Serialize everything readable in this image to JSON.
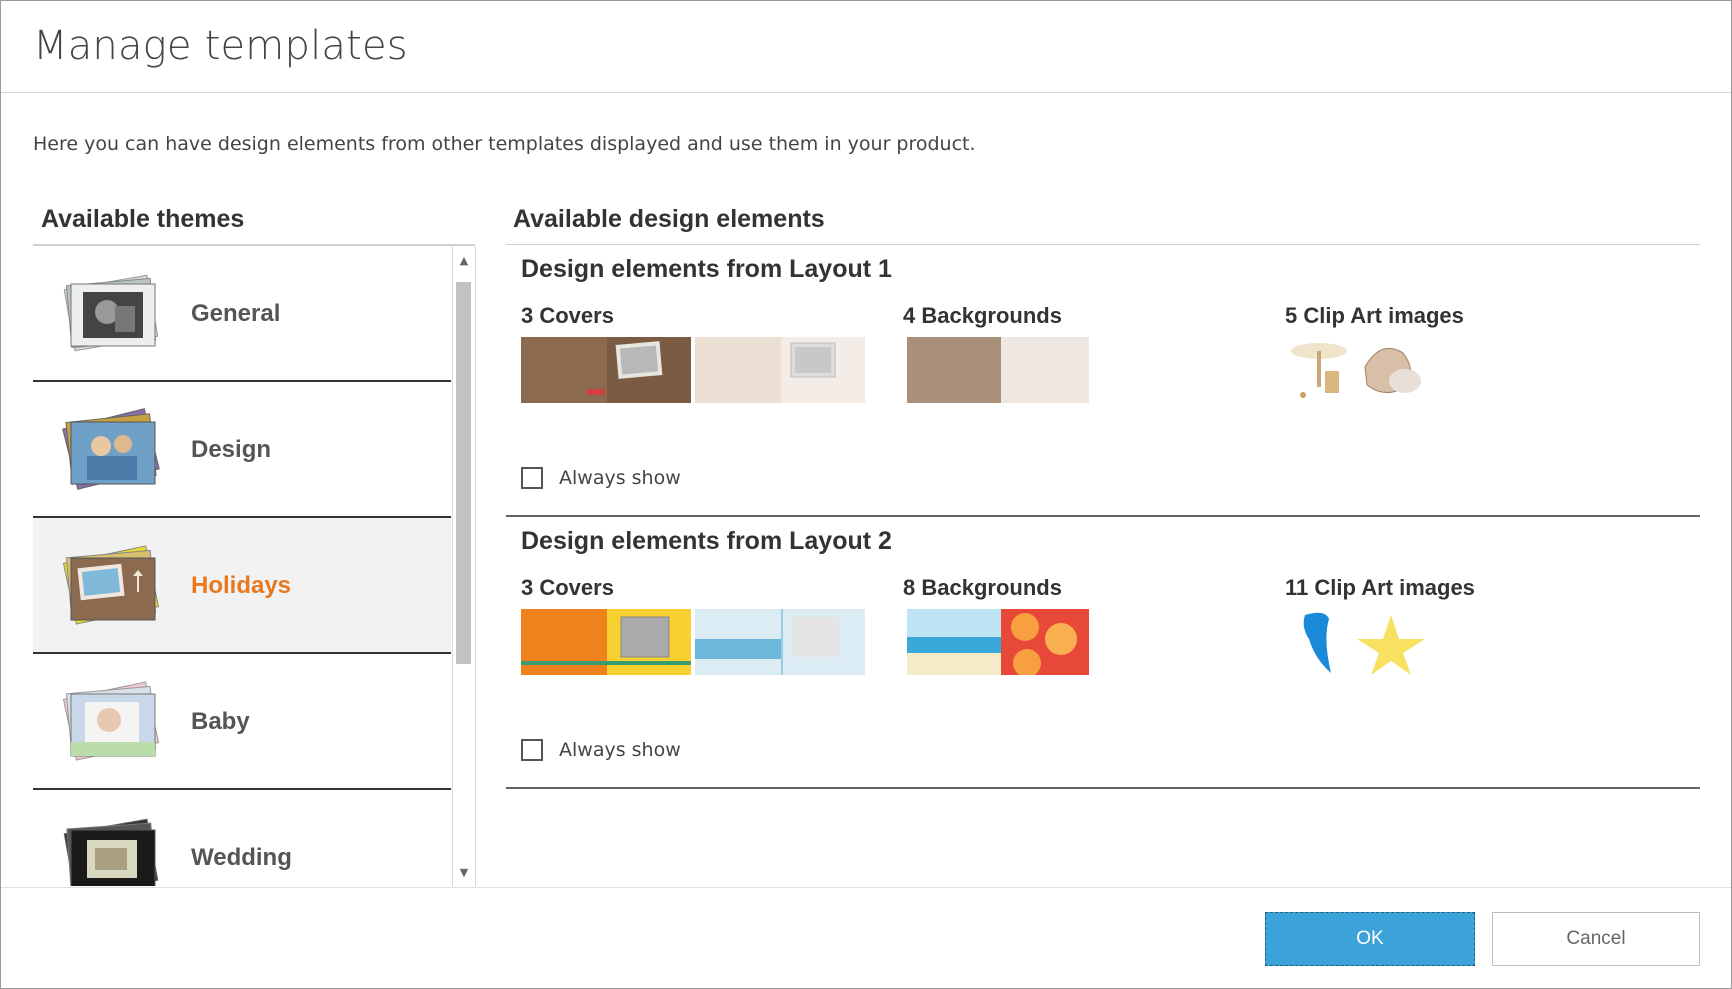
{
  "dialog": {
    "title": "Manage templates",
    "description": "Here you can have design elements from other templates displayed and use them in your product."
  },
  "themes": {
    "heading": "Available themes",
    "items": [
      {
        "label": "General"
      },
      {
        "label": "Design"
      },
      {
        "label": "Holidays",
        "selected": true
      },
      {
        "label": "Baby"
      },
      {
        "label": "Wedding"
      }
    ]
  },
  "elements": {
    "heading": "Available design elements",
    "groups": [
      {
        "title": "Design elements from Layout 1",
        "covers": "3 Covers",
        "backgrounds": "4 Backgrounds",
        "clipart": "5 Clip Art images",
        "always_show": "Always show"
      },
      {
        "title": "Design elements from Layout 2",
        "covers": "3 Covers",
        "backgrounds": "8 Backgrounds",
        "clipart": "11 Clip Art images",
        "always_show": "Always show"
      }
    ]
  },
  "footer": {
    "ok": "OK",
    "cancel": "Cancel"
  },
  "colors": {
    "accent_orange": "#e8781e",
    "ok_blue": "#3ba3d9"
  }
}
